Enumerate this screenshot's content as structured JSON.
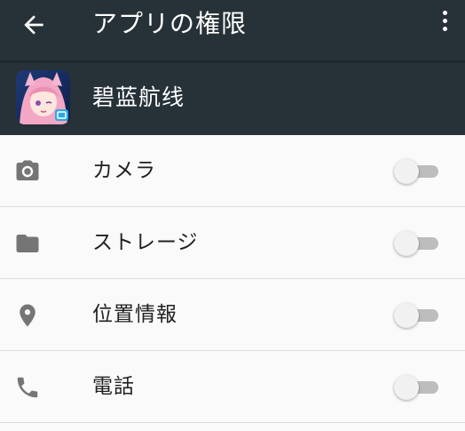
{
  "toolbar": {
    "title": "アプリの権限",
    "back_icon": "arrow-back-icon",
    "more_icon": "more-vert-icon"
  },
  "app": {
    "name": "碧蓝航线",
    "icon": "app-icon"
  },
  "permissions": [
    {
      "label": "カメラ",
      "icon": "camera-icon",
      "enabled": false
    },
    {
      "label": "ストレージ",
      "icon": "folder-icon",
      "enabled": false
    },
    {
      "label": "位置情報",
      "icon": "location-pin-icon",
      "enabled": false
    },
    {
      "label": "電話",
      "icon": "phone-icon",
      "enabled": false
    }
  ],
  "colors": {
    "toolbar_bg": "#263238",
    "page_bg": "#fafafa",
    "icon_gray": "#757575",
    "switch_track_off": "#bdbdbd",
    "switch_thumb_off": "#f1f1f1"
  }
}
